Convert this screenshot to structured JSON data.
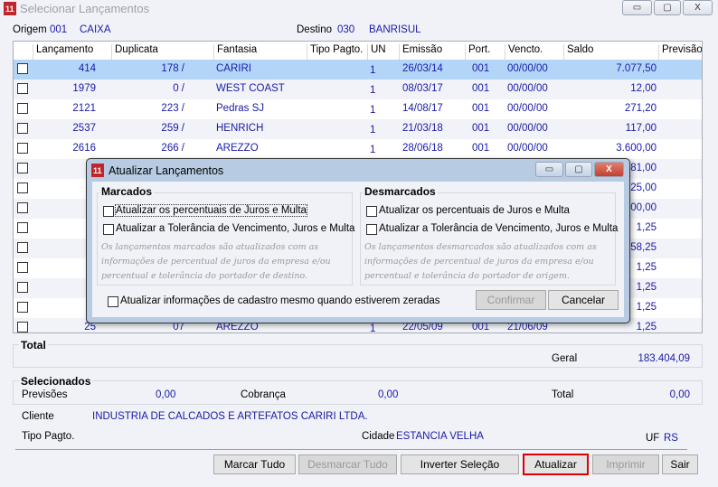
{
  "window": {
    "title": "Selecionar Lançamentos",
    "minimize": "▭",
    "maximize": "▢",
    "close": "X"
  },
  "origem": {
    "label": "Origem",
    "code": "001",
    "name": "CAIXA"
  },
  "destino": {
    "label": "Destino",
    "code": "030",
    "name": "BANRISUL"
  },
  "grid": {
    "columns": [
      "Lançamento",
      "Duplicata",
      "Fantasia",
      "Tipo Pagto.",
      "UN",
      "Emissão",
      "Port.",
      "Vencto.",
      "Saldo",
      "Previsão"
    ],
    "rows": [
      {
        "lanc": "414",
        "dup": "178 /",
        "fant": "CARIRI",
        "tipo": "",
        "un": "1",
        "emis": "26/03/14",
        "port": "001",
        "venc": "00/00/00",
        "saldo": "7.077,50",
        "prev": "",
        "selected": true
      },
      {
        "lanc": "1979",
        "dup": "0 /",
        "fant": "WEST COAST",
        "tipo": "",
        "un": "1",
        "emis": "08/03/17",
        "port": "001",
        "venc": "00/00/00",
        "saldo": "12,00",
        "prev": ""
      },
      {
        "lanc": "2121",
        "dup": "223 /",
        "fant": "Pedras SJ",
        "tipo": "",
        "un": "1",
        "emis": "14/08/17",
        "port": "001",
        "venc": "00/00/00",
        "saldo": "271,20",
        "prev": ""
      },
      {
        "lanc": "2537",
        "dup": "259 /",
        "fant": "HENRICH",
        "tipo": "",
        "un": "1",
        "emis": "21/03/18",
        "port": "001",
        "venc": "00/00/00",
        "saldo": "117,00",
        "prev": ""
      },
      {
        "lanc": "2616",
        "dup": "266 /",
        "fant": "AREZZO",
        "tipo": "",
        "un": "1",
        "emis": "28/06/18",
        "port": "001",
        "venc": "00/00/00",
        "saldo": "3.600,00",
        "prev": ""
      },
      {
        "lanc": "",
        "dup": "",
        "fant": "",
        "tipo": "",
        "un": "",
        "emis": "",
        "port": "",
        "venc": "",
        "saldo": "81,00",
        "prev": ""
      },
      {
        "lanc": "",
        "dup": "",
        "fant": "",
        "tipo": "",
        "un": "",
        "emis": "",
        "port": "",
        "venc": "",
        "saldo": "25,00",
        "prev": ""
      },
      {
        "lanc": "",
        "dup": "",
        "fant": "",
        "tipo": "",
        "un": "",
        "emis": "",
        "port": "",
        "venc": "",
        "saldo": "00,00",
        "prev": ""
      },
      {
        "lanc": "",
        "dup": "",
        "fant": "",
        "tipo": "",
        "un": "",
        "emis": "",
        "port": "",
        "venc": "",
        "saldo": "1,25",
        "prev": ""
      },
      {
        "lanc": "",
        "dup": "",
        "fant": "",
        "tipo": "",
        "un": "",
        "emis": "",
        "port": "",
        "venc": "",
        "saldo": "58,25",
        "prev": ""
      },
      {
        "lanc": "",
        "dup": "",
        "fant": "",
        "tipo": "",
        "un": "",
        "emis": "",
        "port": "",
        "venc": "",
        "saldo": "1,25",
        "prev": ""
      },
      {
        "lanc": "",
        "dup": "",
        "fant": "",
        "tipo": "",
        "un": "",
        "emis": "",
        "port": "",
        "venc": "",
        "saldo": "1,25",
        "prev": ""
      },
      {
        "lanc": "",
        "dup": "",
        "fant": "",
        "tipo": "",
        "un": "",
        "emis": "",
        "port": "",
        "venc": "",
        "saldo": "1,25",
        "prev": ""
      },
      {
        "lanc": "25",
        "dup": "07",
        "fant": "AREZZO",
        "tipo": "",
        "un": "1",
        "emis": "22/05/09",
        "port": "001",
        "venc": "21/06/09",
        "saldo": "1,25",
        "prev": ""
      }
    ]
  },
  "dialog": {
    "title": "Atualizar Lançamentos",
    "marcados": {
      "label": "Marcados",
      "opt1": "Atualizar os percentuais de Juros e Multa",
      "opt2": "Atualizar a Tolerância de Vencimento, Juros e Multa",
      "note": "Os lançamentos marcados são atualizados com as informações de percentual de juros da empresa e/ou percentual e tolerância do portador de destino."
    },
    "desmarcados": {
      "label": "Desmarcados",
      "opt1": "Atualizar os percentuais de Juros e Multa",
      "opt2": "Atualizar a Tolerância de Vencimento, Juros e Multa",
      "note": "Os lançamentos desmarcados são atualizados com as informações de percentual de juros da empresa e/ou percentual e tolerância do portador de origem."
    },
    "cadastro": "Atualizar informações de cadastro mesmo quando estiverem zeradas",
    "confirmar": "Confirmar",
    "cancelar": "Cancelar"
  },
  "total": {
    "label": "Total",
    "geral_label": "Geral",
    "geral": "183.404,09"
  },
  "selecionados": {
    "label": "Selecionados",
    "previsoes_label": "Previsões",
    "previsoes": "0,00",
    "cobranca_label": "Cobrança",
    "cobranca": "0,00",
    "total_label": "Total",
    "total": "0,00"
  },
  "cliente": {
    "label": "Cliente",
    "value": "INDUSTRIA DE CALCADOS E ARTEFATOS CARIRI LTDA."
  },
  "tipo_pagto": {
    "label": "Tipo Pagto.",
    "value": ""
  },
  "cidade": {
    "label": "Cidade",
    "value": "ESTANCIA VELHA"
  },
  "uf": {
    "label": "UF",
    "value": "RS"
  },
  "buttons": {
    "marcar": "Marcar Tudo",
    "desmarcar": "Desmarcar Tudo",
    "inverter": "Inverter Seleção",
    "atualizar": "Atualizar",
    "imprimir": "Imprimir",
    "sair": "Sair"
  },
  "colors": {
    "accent_text": "#1a1aa8",
    "selected_row": "#b3d6f8",
    "highlight_border": "#e00000"
  }
}
